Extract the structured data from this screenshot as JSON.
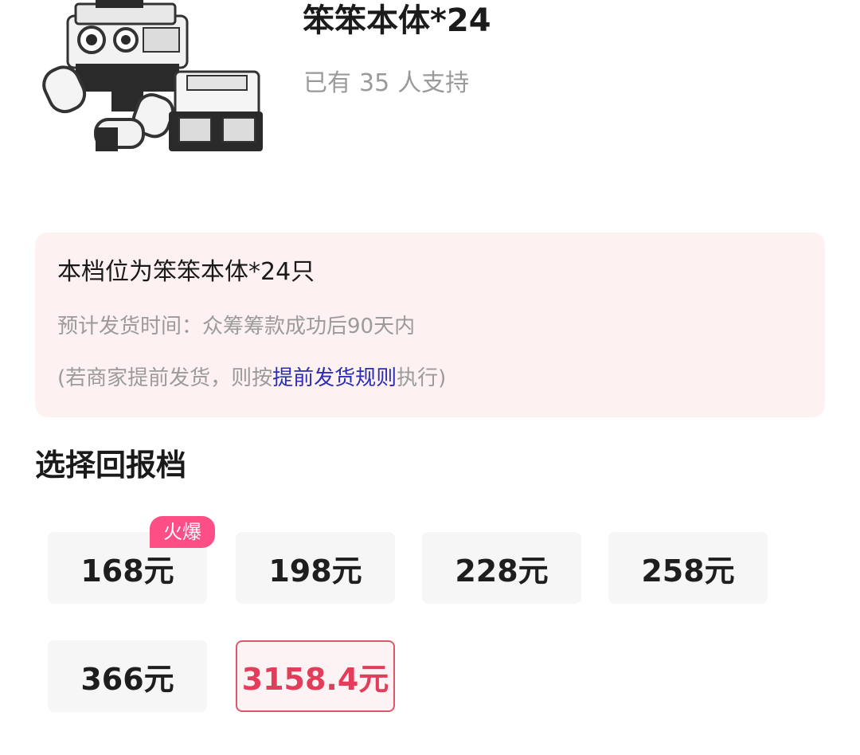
{
  "product": {
    "image_icon": "robot-product-image",
    "title": "笨笨本体*24",
    "supporters": {
      "prefix": "已有",
      "count": "35",
      "suffix": "人支持"
    }
  },
  "tier_info": {
    "description": "本档位为笨笨本体*24只",
    "ship_time": "预计发货时间：众筹筹款成功后90天内",
    "note_prefix": "(若商家提前发货，则按",
    "note_link": "提前发货规则",
    "note_suffix": "执行)"
  },
  "reward_section": {
    "title": "选择回报档",
    "hot_badge": "火爆",
    "options": [
      "168元",
      "198元",
      "228元",
      "258元",
      "366元",
      "3158.4元"
    ],
    "selected_index": 5
  },
  "colors": {
    "accent": "#e23d5a",
    "badge": "#fd4f86",
    "card_bg": "#fdf1f1",
    "link": "#2b2db5"
  }
}
